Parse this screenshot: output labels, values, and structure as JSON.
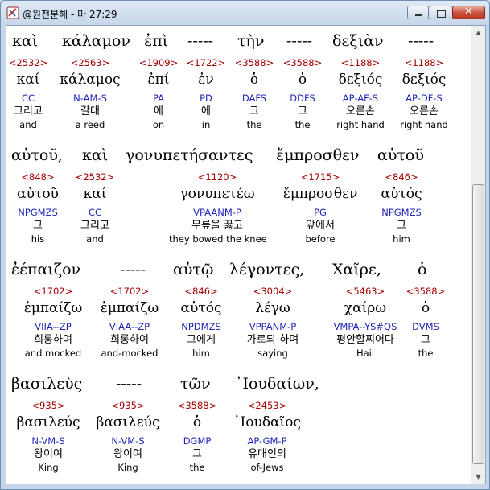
{
  "window": {
    "title": "@원전분해 - 마 27:29",
    "close_label": "✕"
  },
  "rows": [
    {
      "header": [
        "καὶ",
        "κάλαμον",
        "ἐπὶ",
        "-----",
        "τὴν",
        "-----",
        "δεξιὰν",
        "-----"
      ],
      "words": [
        {
          "num": "<2532>",
          "lemma": "καί",
          "parse": "CC",
          "korean": "그리고",
          "english": "and"
        },
        {
          "num": "<2563>",
          "lemma": "κάλαμος",
          "parse": "N-AM-S",
          "korean": "갈대",
          "english": "a reed"
        },
        {
          "num": "<1909>",
          "lemma": "ἐπί",
          "parse": "PA",
          "korean": "에",
          "english": "on"
        },
        {
          "num": "<1722>",
          "lemma": "ἐν",
          "parse": "PD",
          "korean": "에",
          "english": "in"
        },
        {
          "num": "<3588>",
          "lemma": "ὁ",
          "parse": "DAFS",
          "korean": "그",
          "english": "the"
        },
        {
          "num": "<3588>",
          "lemma": "ὁ",
          "parse": "DDFS",
          "korean": "그",
          "english": "the"
        },
        {
          "num": "<1188>",
          "lemma": "δεξιός",
          "parse": "AP-AF-S",
          "korean": "오른손",
          "english": "right hand"
        },
        {
          "num": "<1188>",
          "lemma": "δεξιός",
          "parse": "AP-DF-S",
          "korean": "오른손",
          "english": "right hand"
        }
      ]
    },
    {
      "header": [
        "αὐτοῦ,",
        "καὶ",
        "γονυπετήσαντες",
        "ἔμπροσθεν",
        "αὐτοῦ"
      ],
      "words": [
        {
          "num": "<848>",
          "lemma": "αὑτοῦ",
          "parse": "NPGMZS",
          "korean": "그",
          "english": "his"
        },
        {
          "num": "<2532>",
          "lemma": "καί",
          "parse": "CC",
          "korean": "그리고",
          "english": "and"
        },
        {
          "num": "<1120>",
          "lemma": "γονυπετέω",
          "parse": "VPAANM-P",
          "korean": "무릎을 꿇고",
          "english": "they bowed the knee"
        },
        {
          "num": "<1715>",
          "lemma": "ἔμπροσθεν",
          "parse": "PG",
          "korean": "앞에서",
          "english": "before"
        },
        {
          "num": "<846>",
          "lemma": "αὐτός",
          "parse": "NPGMZS",
          "korean": "그",
          "english": "him"
        }
      ]
    },
    {
      "header": [
        "ἐέπαιζον",
        "-----",
        "αὐτῷ",
        "λέγοντες,",
        "Χαῖρε,",
        "ὁ"
      ],
      "words": [
        {
          "num": "<1702>",
          "lemma": "ἐμπαίζω",
          "parse": "VIIA--ZP",
          "korean": "희롱하여",
          "english": "and mocked"
        },
        {
          "num": "<1702>",
          "lemma": "ἐμπαίζω",
          "parse": "VIAA--ZP",
          "korean": "희롱하여",
          "english": "and-mocked"
        },
        {
          "num": "<846>",
          "lemma": "αὐτός",
          "parse": "NPDMZS",
          "korean": "그에게",
          "english": "him"
        },
        {
          "num": "<3004>",
          "lemma": "λέγω",
          "parse": "VPPANM-P",
          "korean": "가로되-하며",
          "english": "saying"
        },
        {
          "num": "<5463>",
          "lemma": "χαίρω",
          "parse": "VMPA--YS#QS",
          "korean": "평안할찌어다",
          "english": "Hail"
        },
        {
          "num": "<3588>",
          "lemma": "ὁ",
          "parse": "DVMS",
          "korean": "그",
          "english": "the"
        }
      ]
    },
    {
      "header": [
        "βασιλεὺς",
        "-----",
        "τῶν",
        "᾿Ιουδαίων,"
      ],
      "words": [
        {
          "num": "<935>",
          "lemma": "βασιλεύς",
          "parse": "N-VM-S",
          "korean": "왕이여",
          "english": "King"
        },
        {
          "num": "<935>",
          "lemma": "βασιλεύς",
          "parse": "N-VM-S",
          "korean": "왕이여",
          "english": "King"
        },
        {
          "num": "<3588>",
          "lemma": "ὁ",
          "parse": "DGMP",
          "korean": "그",
          "english": "the"
        },
        {
          "num": "<2453>",
          "lemma": "᾿Ιουδαῖος",
          "parse": "AP-GM-P",
          "korean": "유대인의",
          "english": "of-Jews"
        }
      ]
    }
  ]
}
